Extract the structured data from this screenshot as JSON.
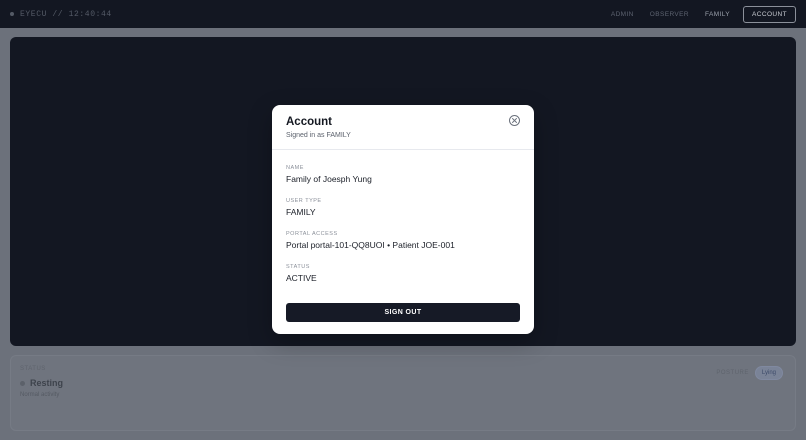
{
  "header": {
    "brand": "EYECU // 12:40:44",
    "nav": [
      {
        "label": "ADMIN"
      },
      {
        "label": "OBSERVER"
      },
      {
        "label": "FAMILY"
      }
    ],
    "account_label": "ACCOUNT"
  },
  "status_panel": {
    "label": "STATUS",
    "value": "Resting",
    "subtext": "Normal activity",
    "posture_label": "POSTURE",
    "posture_value": "Lying"
  },
  "modal": {
    "title": "Account",
    "subtitle": "Signed in as FAMILY",
    "fields": [
      {
        "label": "NAME",
        "value": "Family of Joesph Yung"
      },
      {
        "label": "USER TYPE",
        "value": "FAMILY"
      },
      {
        "label": "PORTAL ACCESS",
        "value": "Portal portal-101-QQ8UOI • Patient JOE-001"
      },
      {
        "label": "STATUS",
        "value": "ACTIVE"
      }
    ],
    "signout_label": "SIGN OUT"
  },
  "icons": {
    "close": "close-circle-icon",
    "brand_dot": "status-dot-icon"
  }
}
